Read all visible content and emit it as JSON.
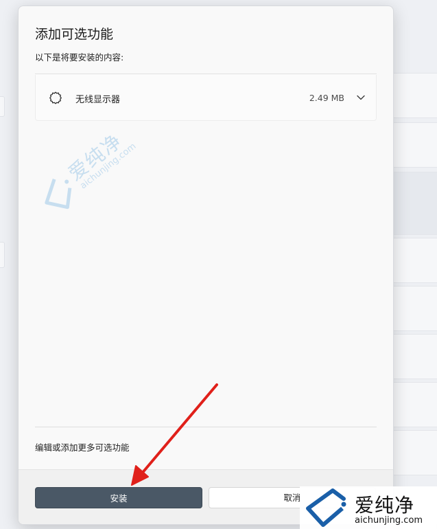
{
  "dialog": {
    "title": "添加可选功能",
    "subtitle": "以下是将要安装的内容:",
    "feature": {
      "name": "无线显示器",
      "size": "2.49 MB",
      "icon": "puzzle-gear-icon"
    },
    "more_link": "编辑或添加更多可选功能",
    "install_label": "安装",
    "cancel_label": "取消"
  },
  "watermark": {
    "cn": "爱纯净",
    "en": "aichunjing.com"
  },
  "colors": {
    "install_button": "#4a5866",
    "annotation_arrow": "#e0201a",
    "watermark_blue": "#9fc8e8"
  }
}
